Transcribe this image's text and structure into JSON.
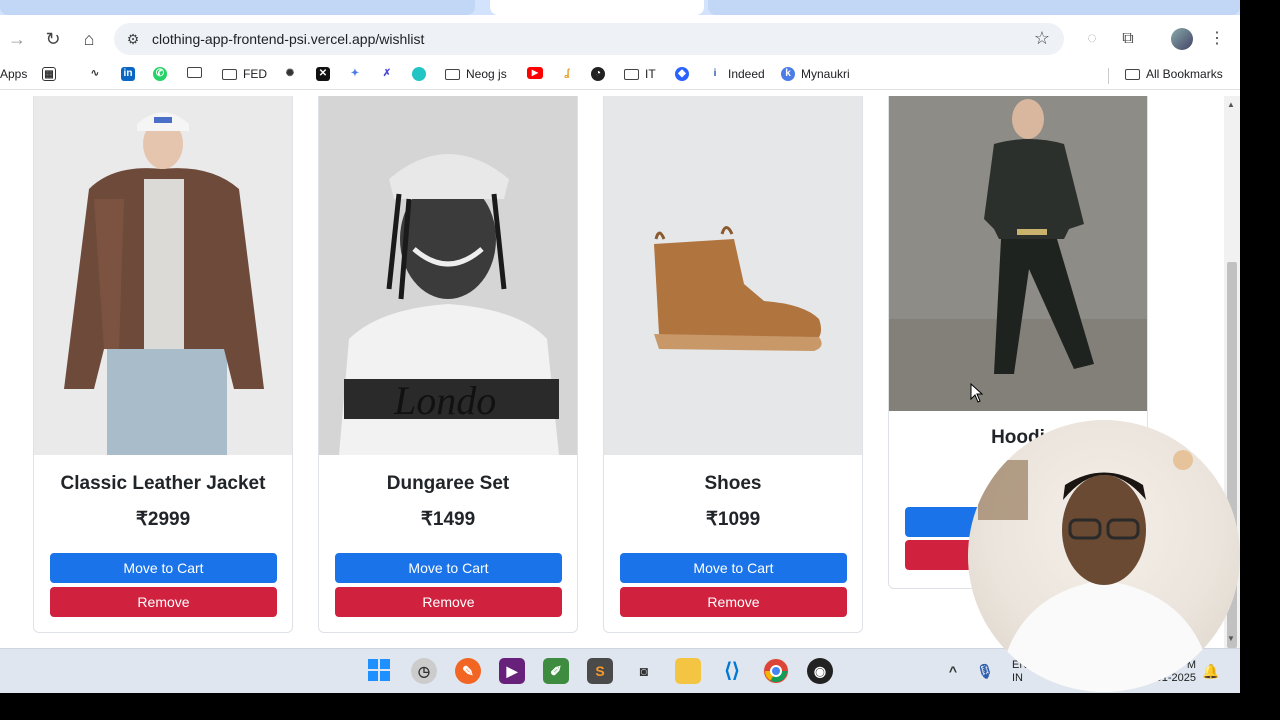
{
  "browser": {
    "url": "clothing-app-frontend-psi.vercel.app/wishlist"
  },
  "bookmarks": [
    {
      "label": "Apps",
      "icon": "apps-icon"
    },
    {
      "label": "FED",
      "icon": "folder-icon"
    },
    {
      "label": "Neog js",
      "icon": "folder-icon"
    },
    {
      "label": "IT",
      "icon": "folder-icon"
    },
    {
      "label": "Indeed",
      "icon": "indeed-icon"
    },
    {
      "label": "Mynaukri",
      "icon": "mynaukri-icon"
    },
    {
      "label": "All Bookmarks",
      "icon": "folder-icon"
    }
  ],
  "wishlist": [
    {
      "name": "Classic Leather Jacket",
      "price": "₹2999",
      "move_label": "Move to Cart",
      "remove_label": "Remove"
    },
    {
      "name": "Dungaree Set",
      "price": "₹1499",
      "move_label": "Move to Cart",
      "remove_label": "Remove"
    },
    {
      "name": "Shoes",
      "price": "₹1099",
      "move_label": "Move to Cart",
      "remove_label": "Remove"
    },
    {
      "name": "Hoodi",
      "price": "",
      "move_label": "",
      "remove_label": ""
    }
  ],
  "taskbar": {
    "lang_top": "ENG",
    "lang_bottom": "IN",
    "time": "PM",
    "date": "-01-2025"
  },
  "colors": {
    "cart_button": "#1a73e8",
    "remove_button": "#d0223f"
  }
}
